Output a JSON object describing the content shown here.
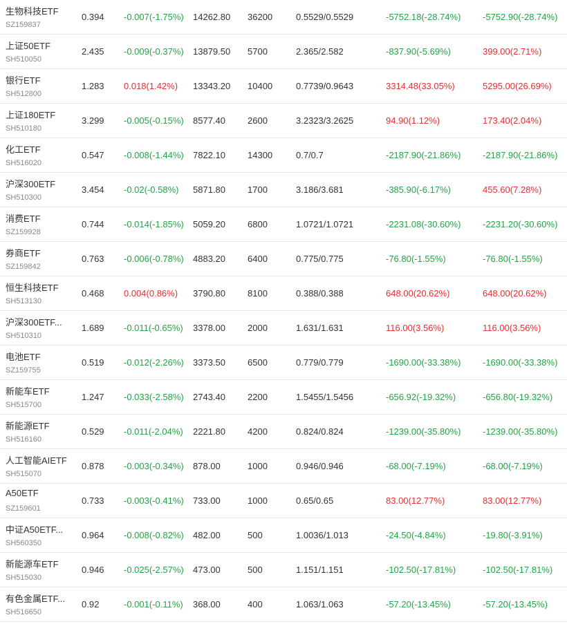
{
  "colors": {
    "up": "#e0302d",
    "down": "#25a244"
  },
  "rows": [
    {
      "name": "生物科技ETF",
      "code": "SZ159837",
      "price": "0.394",
      "change": "-0.007(-1.75%)",
      "change_dir": "down",
      "value": "14262.80",
      "qty": "36200",
      "cost": "0.5529/0.5529",
      "pl": "-5752.18(-28.74%)",
      "pl_dir": "down",
      "pl2": "-5752.90(-28.74%)",
      "pl2_dir": "down"
    },
    {
      "name": "上证50ETF",
      "code": "SH510050",
      "price": "2.435",
      "change": "-0.009(-0.37%)",
      "change_dir": "down",
      "value": "13879.50",
      "qty": "5700",
      "cost": "2.365/2.582",
      "pl": "-837.90(-5.69%)",
      "pl_dir": "down",
      "pl2": "399.00(2.71%)",
      "pl2_dir": "up"
    },
    {
      "name": "银行ETF",
      "code": "SH512800",
      "price": "1.283",
      "change": "0.018(1.42%)",
      "change_dir": "up",
      "value": "13343.20",
      "qty": "10400",
      "cost": "0.7739/0.9643",
      "pl": "3314.48(33.05%)",
      "pl_dir": "up",
      "pl2": "5295.00(26.69%)",
      "pl2_dir": "up"
    },
    {
      "name": "上证180ETF",
      "code": "SH510180",
      "price": "3.299",
      "change": "-0.005(-0.15%)",
      "change_dir": "down",
      "value": "8577.40",
      "qty": "2600",
      "cost": "3.2323/3.2625",
      "pl": "94.90(1.12%)",
      "pl_dir": "up",
      "pl2": "173.40(2.04%)",
      "pl2_dir": "up"
    },
    {
      "name": "化工ETF",
      "code": "SH516020",
      "price": "0.547",
      "change": "-0.008(-1.44%)",
      "change_dir": "down",
      "value": "7822.10",
      "qty": "14300",
      "cost": "0.7/0.7",
      "pl": "-2187.90(-21.86%)",
      "pl_dir": "down",
      "pl2": "-2187.90(-21.86%)",
      "pl2_dir": "down"
    },
    {
      "name": "沪深300ETF",
      "code": "SH510300",
      "price": "3.454",
      "change": "-0.02(-0.58%)",
      "change_dir": "down",
      "value": "5871.80",
      "qty": "1700",
      "cost": "3.186/3.681",
      "pl": "-385.90(-6.17%)",
      "pl_dir": "down",
      "pl2": "455.60(7.28%)",
      "pl2_dir": "up"
    },
    {
      "name": "消费ETF",
      "code": "SZ159928",
      "price": "0.744",
      "change": "-0.014(-1.85%)",
      "change_dir": "down",
      "value": "5059.20",
      "qty": "6800",
      "cost": "1.0721/1.0721",
      "pl": "-2231.08(-30.60%)",
      "pl_dir": "down",
      "pl2": "-2231.20(-30.60%)",
      "pl2_dir": "down"
    },
    {
      "name": "券商ETF",
      "code": "SZ159842",
      "price": "0.763",
      "change": "-0.006(-0.78%)",
      "change_dir": "down",
      "value": "4883.20",
      "qty": "6400",
      "cost": "0.775/0.775",
      "pl": "-76.80(-1.55%)",
      "pl_dir": "down",
      "pl2": "-76.80(-1.55%)",
      "pl2_dir": "down"
    },
    {
      "name": "恒生科技ETF",
      "code": "SH513130",
      "price": "0.468",
      "change": "0.004(0.86%)",
      "change_dir": "up",
      "value": "3790.80",
      "qty": "8100",
      "cost": "0.388/0.388",
      "pl": "648.00(20.62%)",
      "pl_dir": "up",
      "pl2": "648.00(20.62%)",
      "pl2_dir": "up"
    },
    {
      "name": "沪深300ETF...",
      "code": "SH510310",
      "price": "1.689",
      "change": "-0.011(-0.65%)",
      "change_dir": "down",
      "value": "3378.00",
      "qty": "2000",
      "cost": "1.631/1.631",
      "pl": "116.00(3.56%)",
      "pl_dir": "up",
      "pl2": "116.00(3.56%)",
      "pl2_dir": "up"
    },
    {
      "name": "电池ETF",
      "code": "SZ159755",
      "price": "0.519",
      "change": "-0.012(-2.26%)",
      "change_dir": "down",
      "value": "3373.50",
      "qty": "6500",
      "cost": "0.779/0.779",
      "pl": "-1690.00(-33.38%)",
      "pl_dir": "down",
      "pl2": "-1690.00(-33.38%)",
      "pl2_dir": "down"
    },
    {
      "name": "新能车ETF",
      "code": "SH515700",
      "price": "1.247",
      "change": "-0.033(-2.58%)",
      "change_dir": "down",
      "value": "2743.40",
      "qty": "2200",
      "cost": "1.5455/1.5456",
      "pl": "-656.92(-19.32%)",
      "pl_dir": "down",
      "pl2": "-656.80(-19.32%)",
      "pl2_dir": "down"
    },
    {
      "name": "新能源ETF",
      "code": "SH516160",
      "price": "0.529",
      "change": "-0.011(-2.04%)",
      "change_dir": "down",
      "value": "2221.80",
      "qty": "4200",
      "cost": "0.824/0.824",
      "pl": "-1239.00(-35.80%)",
      "pl_dir": "down",
      "pl2": "-1239.00(-35.80%)",
      "pl2_dir": "down"
    },
    {
      "name": "人工智能AIETF",
      "code": "SH515070",
      "price": "0.878",
      "change": "-0.003(-0.34%)",
      "change_dir": "down",
      "value": "878.00",
      "qty": "1000",
      "cost": "0.946/0.946",
      "pl": "-68.00(-7.19%)",
      "pl_dir": "down",
      "pl2": "-68.00(-7.19%)",
      "pl2_dir": "down"
    },
    {
      "name": "A50ETF",
      "code": "SZ159601",
      "price": "0.733",
      "change": "-0.003(-0.41%)",
      "change_dir": "down",
      "value": "733.00",
      "qty": "1000",
      "cost": "0.65/0.65",
      "pl": "83.00(12.77%)",
      "pl_dir": "up",
      "pl2": "83.00(12.77%)",
      "pl2_dir": "up"
    },
    {
      "name": "中证A50ETF...",
      "code": "SH560350",
      "price": "0.964",
      "change": "-0.008(-0.82%)",
      "change_dir": "down",
      "value": "482.00",
      "qty": "500",
      "cost": "1.0036/1.013",
      "pl": "-24.50(-4.84%)",
      "pl_dir": "down",
      "pl2": "-19.80(-3.91%)",
      "pl2_dir": "down"
    },
    {
      "name": "新能源车ETF",
      "code": "SH515030",
      "price": "0.946",
      "change": "-0.025(-2.57%)",
      "change_dir": "down",
      "value": "473.00",
      "qty": "500",
      "cost": "1.151/1.151",
      "pl": "-102.50(-17.81%)",
      "pl_dir": "down",
      "pl2": "-102.50(-17.81%)",
      "pl2_dir": "down"
    },
    {
      "name": "有色金属ETF...",
      "code": "SH516650",
      "price": "0.92",
      "change": "-0.001(-0.11%)",
      "change_dir": "down",
      "value": "368.00",
      "qty": "400",
      "cost": "1.063/1.063",
      "pl": "-57.20(-13.45%)",
      "pl_dir": "down",
      "pl2": "-57.20(-13.45%)",
      "pl2_dir": "down"
    }
  ]
}
